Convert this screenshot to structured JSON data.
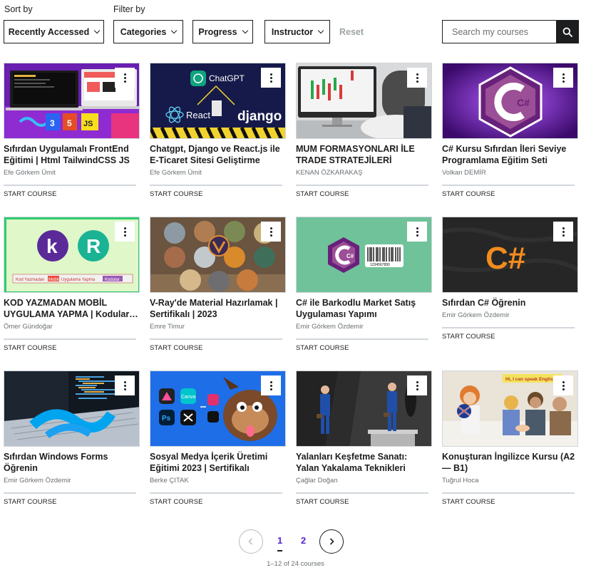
{
  "filters": {
    "sort_label": "Sort by",
    "filter_label": "Filter by",
    "sort_value": "Recently Accessed",
    "categories": "Categories",
    "progress": "Progress",
    "instructor": "Instructor",
    "reset": "Reset",
    "search_placeholder": "Search my courses"
  },
  "start_label": "START COURSE",
  "courses": [
    {
      "title": "Sıfırdan Uygulamalı FrontEnd Eğitimi | Html TailwindCSS JS",
      "instructor": "Efe Görkem Ümit",
      "thumb_text": [
        "3",
        "5",
        "JS"
      ]
    },
    {
      "title": "Chatgpt, Django ve React.js ile E-Ticaret Sitesi Geliştirme",
      "instructor": "Efe Görkem Ümit",
      "thumb_text": [
        "ChatGPT",
        "React",
        "django"
      ]
    },
    {
      "title": "MUM FORMASYONLARI İLE TRADE STRATEJİLERİ",
      "instructor": "KENAN ÖZKARAKAŞ",
      "thumb_text": []
    },
    {
      "title": "C# Kursu Sıfırdan İleri Seviye Programlama Eğitim Seti",
      "instructor": "Volkan DEMİR",
      "thumb_text": [
        "C#"
      ]
    },
    {
      "title": "KOD YAZMADAN MOBİL UYGULAMA YAPMA | Kodular ile Android Uygulama Geliştirme",
      "instructor": "Ömer Gündoğar",
      "thumb_text": [
        "k",
        "R",
        "Kod Yazmadan",
        "Mobil",
        "Uygulama Yapma",
        "Kodular"
      ]
    },
    {
      "title": "V-Ray'de Material Hazırlamak | Sertifikalı | 2023",
      "instructor": "Emre Timur",
      "thumb_text": []
    },
    {
      "title": "C# ile Barkodlu Market Satış Uygulaması Yapımı",
      "instructor": "Emir Görkem Özdemir",
      "thumb_text": [
        "C#",
        "1234567890"
      ]
    },
    {
      "title": "Sıfırdan C# Öğrenin",
      "instructor": "Emir Görkem Özdemir",
      "thumb_text": [
        "C#"
      ]
    },
    {
      "title": "Sıfırdan Windows Forms Öğrenin",
      "instructor": "Emir Görkem Özdemir",
      "thumb_text": []
    },
    {
      "title": "Sosyal Medya İçerik Üretimi Eğitimi 2023 | Sertifikalı",
      "instructor": "Berke ÇITAK",
      "thumb_text": [
        "Canva",
        "Ps"
      ]
    },
    {
      "title": "Yalanları Keşfetme Sanatı: Yalan Yakalama Teknikleri",
      "instructor": "Çağlar Doğan",
      "thumb_text": []
    },
    {
      "title": "Konuşturan İngilizce Kursu (A2 — B1)",
      "instructor": "Tuğrul Hoca",
      "thumb_text": [
        "Hi, I can speak English."
      ]
    }
  ],
  "pagination": {
    "pages": [
      "1",
      "2"
    ],
    "current": "1",
    "info": "1–12 of 24 courses"
  },
  "icons": {
    "search": "search-icon",
    "kebab": "more-vertical-icon",
    "prev": "chevron-left-icon",
    "next": "chevron-right-icon"
  },
  "colors": {
    "text": "#1c1d1f",
    "muted": "#6a6f73",
    "accent": "#5624d0",
    "disabled": "#9da3a7"
  }
}
